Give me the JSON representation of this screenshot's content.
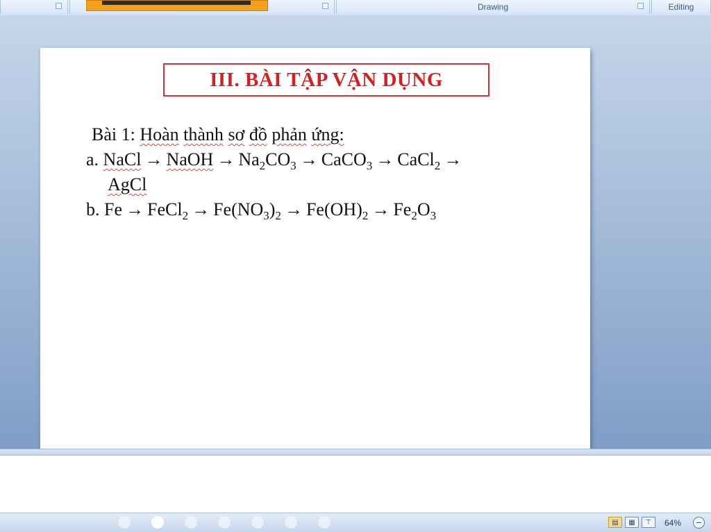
{
  "ribbon": {
    "groups": [
      {
        "label": ""
      },
      {
        "label": ""
      },
      {
        "label": "Drawing"
      },
      {
        "label": "Editing"
      }
    ]
  },
  "slide": {
    "title": "III. BÀI TẬP VẬN DỤNG",
    "exercise_heading": "Bài 1: Hoàn thành sơ đồ phản ứng:",
    "line_a": {
      "prefix": "a.",
      "species": [
        "NaCl",
        "NaOH",
        "Na",
        "2",
        "CO",
        "3",
        "CaCO",
        "3",
        "CaCl",
        "2",
        "AgCl"
      ]
    },
    "line_b": {
      "prefix": "b.",
      "species": [
        "Fe",
        "FeCl",
        "2",
        "Fe(NO",
        "3",
        ")",
        "2",
        "Fe(OH)",
        "2",
        "Fe",
        "2",
        "O",
        "3"
      ]
    },
    "arrow": "→"
  },
  "status": {
    "zoom": "64%",
    "zoom_out_symbol": "−",
    "slide_dots_count": 7,
    "active_dot_index": 1
  },
  "colors": {
    "title_red": "#d42020",
    "accent_orange": "#f5a01a",
    "workspace_blue": "#9fb7d6"
  }
}
